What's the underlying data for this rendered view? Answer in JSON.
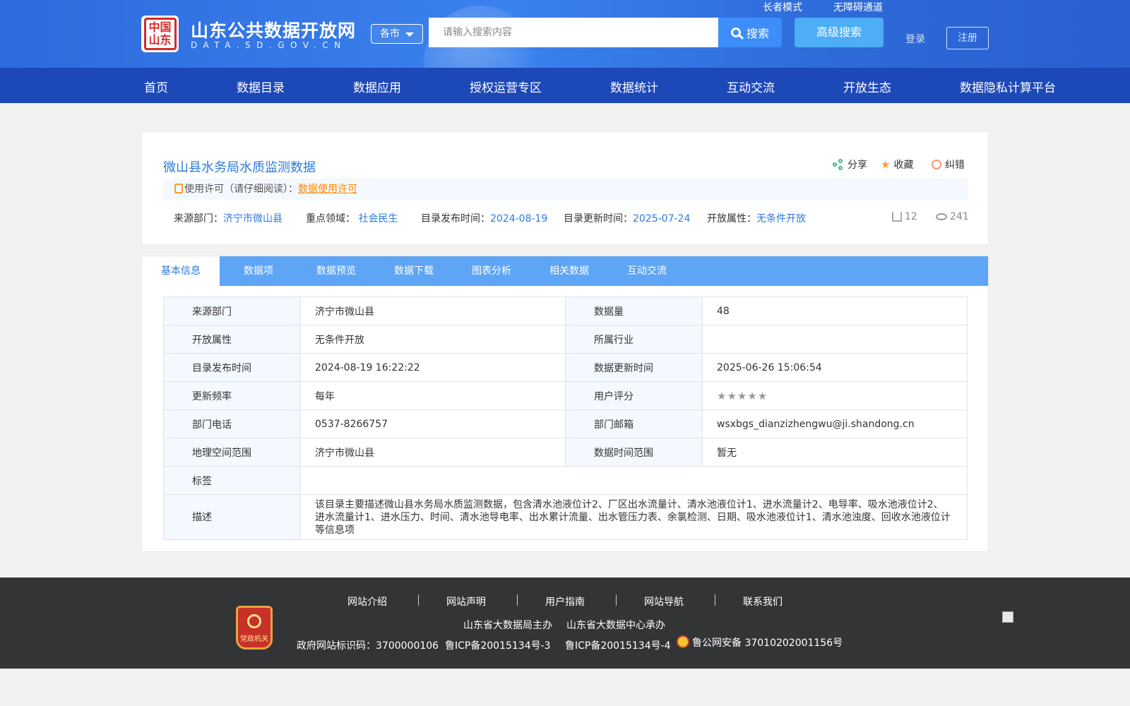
{
  "header": {
    "logo_title": "山东公共数据开放网",
    "logo_subtitle": "DATA.SD.GOV.CN",
    "logo_seal_text": "中国山东",
    "city_select": "各市",
    "search_placeholder": "请输入搜索内容",
    "search_button": "搜索",
    "advanced_search": "高级搜索",
    "elderly_mode": "长者模式",
    "accessibility": "无障碍通道",
    "login": "登录",
    "register": "注册"
  },
  "nav": {
    "items": [
      "首页",
      "数据目录",
      "数据应用",
      "授权运营专区",
      "数据统计",
      "互动交流",
      "开放生态",
      "数据隐私计算平台"
    ]
  },
  "dataset": {
    "title": "微山县水务局水质监测数据",
    "actions": {
      "share": "分享",
      "favorite": "收藏",
      "correct": "纠错"
    },
    "license_prefix": "使用许可（请仔细阅读）：",
    "license_link": "数据使用许可",
    "meta": {
      "source_label": "来源部门：",
      "source_value": "济宁市微山县",
      "domain_label": "重点领域：",
      "domain_value": "社会民生",
      "publish_label": "目录发布时间：",
      "publish_value": "2024-08-19",
      "update_label": "目录更新时间：",
      "update_value": "2025-07-24",
      "open_label": "开放属性：",
      "open_value": "无条件开放"
    },
    "downloads": "12",
    "views": "241"
  },
  "tabs": [
    "基本信息",
    "数据项",
    "数据预览",
    "数据下载",
    "图表分析",
    "相关数据",
    "互动交流"
  ],
  "info_table": {
    "rows": [
      {
        "k1": "来源部门",
        "v1": "济宁市微山县",
        "k2": "数据量",
        "v2": "48"
      },
      {
        "k1": "开放属性",
        "v1": "无条件开放",
        "k2": "所属行业",
        "v2": ""
      },
      {
        "k1": "目录发布时间",
        "v1": "2024-08-19 16:22:22",
        "k2": "数据更新时间",
        "v2": "2025-06-26 15:06:54"
      },
      {
        "k1": "更新频率",
        "v1": "每年",
        "k2": "用户评分",
        "v2": ""
      },
      {
        "k1": "部门电话",
        "v1": "0537-8266757",
        "k2": "部门邮箱",
        "v2": "wsxbgs_dianzizhengwu@ji.shandong.cn"
      },
      {
        "k1": "地理空间范围",
        "v1": "济宁市微山县",
        "k2": "数据时间范围",
        "v2": "暂无"
      }
    ],
    "user_rating": 0,
    "tags_label": "标签",
    "tags_value": "",
    "desc_label": "描述",
    "desc_value": "该目录主要描述微山县水务局水质监测数据，包含清水池液位计2、厂区出水流量计、清水池液位计1、进水流量计2、电导率、吸水池液位计2、进水流量计1、进水压力、时间、清水池导电率、出水累计流量、出水管压力表、余氯检测、日期、吸水池液位计1、清水池浊度、回收水池液位计等信息项"
  },
  "footer": {
    "links": [
      "网站介绍",
      "网站声明",
      "用户指南",
      "网站导航",
      "联系我们"
    ],
    "sponsor": "山东省大数据局主办",
    "organizer": "山东省大数据中心承办",
    "gov_id": "政府网站标识码：3700000106",
    "icp1": "鲁ICP备20015134号-3",
    "icp2": "鲁ICP备20015134号-4",
    "police": "鲁公网安备 37010202001156号",
    "emblem_text": "党政机关"
  }
}
